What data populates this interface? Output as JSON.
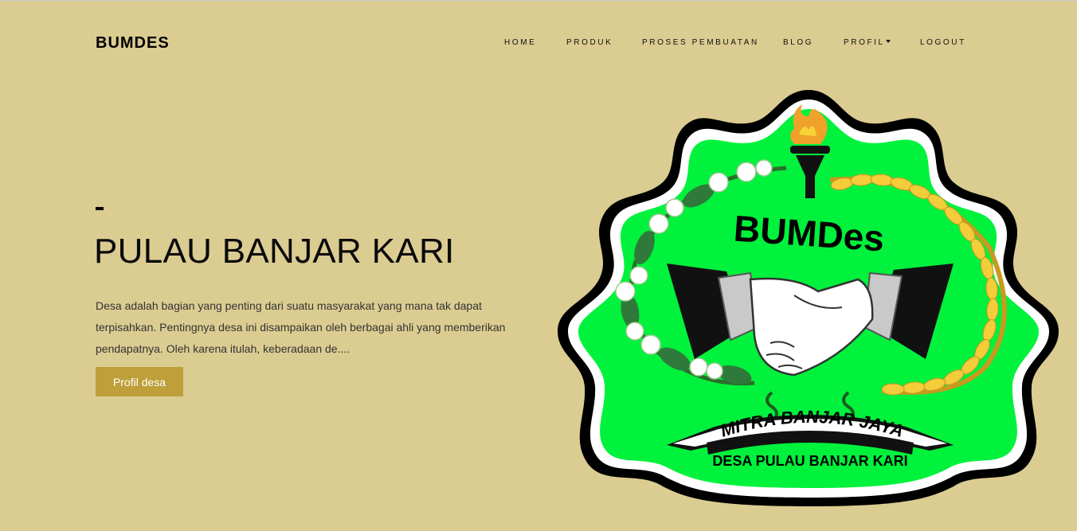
{
  "navbar": {
    "brand": "BUMDES",
    "links": [
      {
        "label": "HOME"
      },
      {
        "label": "PRODUK"
      },
      {
        "label": "PROSES PEMBUATAN"
      },
      {
        "label": "BLOG"
      },
      {
        "label": "PROFIL",
        "dropdown": true
      },
      {
        "label": "LOGOUT"
      }
    ]
  },
  "hero": {
    "title": "PULAU BANJAR KARI",
    "description": "Desa adalah bagian yang penting dari suatu masyarakat yang mana tak dapat terpisahkan. Pentingnya desa ini disampaikan oleh berbagai ahli yang memberikan pendapatnya. Oleh karena itulah, keberadaan de....",
    "button_label": "Profil desa"
  },
  "logo": {
    "top_text": "BUMDes",
    "ribbon_text": "MITRA BANJAR JAYA",
    "bottom_text": "DESA PULAU BANJAR KARI"
  },
  "colors": {
    "background": "#dbcc91",
    "button": "#bf9f3a",
    "logo_green": "#00f23c",
    "wheat": "#f5cc3a"
  }
}
